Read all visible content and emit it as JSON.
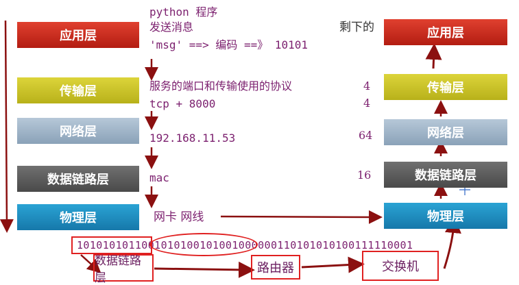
{
  "left_stack": {
    "application": "应用层",
    "transport": "传输层",
    "network": "网络层",
    "datalink": "数据链路层",
    "physical": "物理层"
  },
  "right_stack": {
    "application": "应用层",
    "transport": "传输层",
    "network": "网络层",
    "datalink": "数据链路层",
    "physical": "物理层"
  },
  "notes": {
    "line1": "python 程序",
    "line2": "发送消息",
    "line3": "'msg' ==> 编码 ==》 10101",
    "transport1": "服务的端口和传输使用的协议",
    "transport2": "tcp + 8000",
    "network": "192.168.11.53",
    "datalink": "mac",
    "physical": "网卡  网线",
    "remaining": "剩下的"
  },
  "numbers": {
    "n1": "4",
    "n2": "4",
    "n3": "64",
    "n4": "16"
  },
  "bits": {
    "part1": "10101010110",
    "part2": "010101001010010",
    "part3": "00000110101010100111110001"
  },
  "boxes": {
    "datalink": "数据链路层",
    "router": "路由器",
    "switch": "交换机"
  },
  "colors": {
    "application": "#c8261a",
    "transport": "#cbc424",
    "network": "#9bb3c8",
    "datalink": "#5a5a5a",
    "physical": "#1e8fc2",
    "arrow": "#8b1010",
    "annotation": "#7b1f6e",
    "highlight": "#e02020"
  }
}
